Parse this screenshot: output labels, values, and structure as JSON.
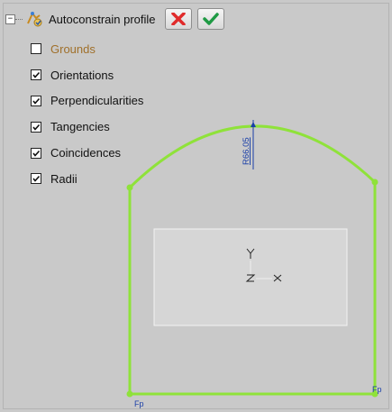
{
  "panel": {
    "title": "Autoconstrain profile",
    "collapse_symbol": "−",
    "cancel_icon": "cancel-x-icon",
    "ok_icon": "ok-check-icon",
    "colors": {
      "disabled_label": "#a0702a",
      "profile_curve": "#8fe23a",
      "annotation": "#1a3fa8"
    }
  },
  "options": [
    {
      "label": "Grounds",
      "checked": false,
      "disabled": true
    },
    {
      "label": "Orientations",
      "checked": true
    },
    {
      "label": "Perpendicularities",
      "checked": true
    },
    {
      "label": "Tangencies",
      "checked": true
    },
    {
      "label": "Coincidences",
      "checked": true
    },
    {
      "label": "Radii",
      "checked": true
    }
  ],
  "sketch": {
    "radius_label": "R66.05",
    "fix_label_left": "Fp",
    "fix_label_right": "Fp"
  }
}
